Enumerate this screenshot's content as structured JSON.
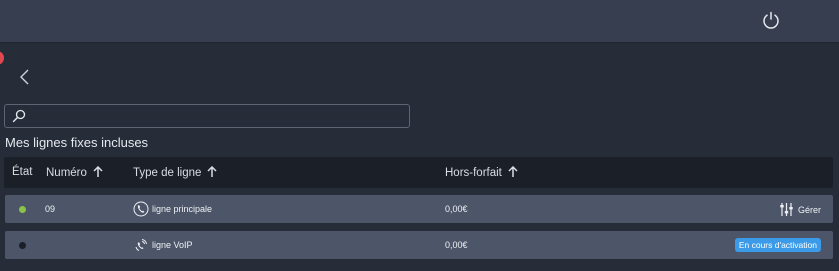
{
  "colors": {
    "topbar": "#363e4f",
    "background": "#262c38",
    "table_header": "#1b1f27",
    "row": "#4d5669",
    "status_active": "#8bc34a",
    "status_inactive": "#1b1f27",
    "badge": "#3b9be8",
    "notification": "#e0484f"
  },
  "header": {
    "power_icon": "power-icon"
  },
  "nav": {
    "back_icon": "chevron-left-icon"
  },
  "search": {
    "icon": "search-icon",
    "placeholder": "",
    "value": ""
  },
  "section": {
    "title": "Mes lignes fixes incluses"
  },
  "table": {
    "columns": [
      {
        "label": "État",
        "sortable": false
      },
      {
        "label": "Numéro",
        "sortable": true
      },
      {
        "label": "Type de ligne",
        "sortable": true
      },
      {
        "label": "Hors-forfait",
        "sortable": true
      }
    ],
    "rows": [
      {
        "status": "active",
        "number": "09",
        "type_icon": "phone-icon",
        "type": "ligne principale",
        "overage": "0,00€",
        "action_icon": "sliders-icon",
        "action_label": "Gérer"
      },
      {
        "status": "inactive",
        "number": "",
        "type_icon": "voip-phone-icon",
        "type": "ligne VoIP",
        "overage": "0,00€",
        "badge": "En cours d'activation"
      }
    ]
  }
}
